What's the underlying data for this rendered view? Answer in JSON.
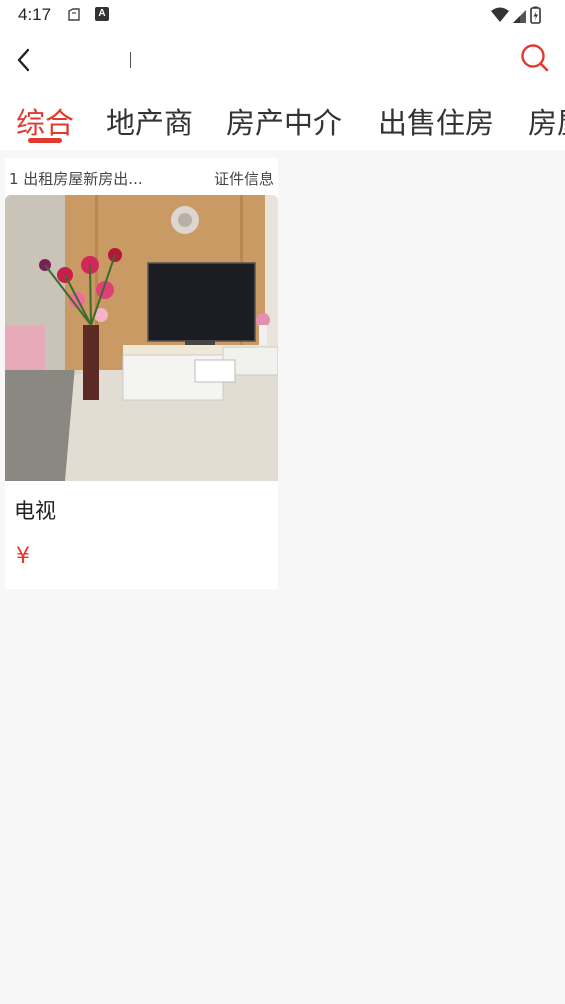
{
  "status_bar": {
    "time": "4:17",
    "notification_icon_letter": "A"
  },
  "header": {
    "search_value": ""
  },
  "tabs": [
    {
      "label": "综合",
      "active": true
    },
    {
      "label": "地产商",
      "active": false
    },
    {
      "label": "房产中介",
      "active": false
    },
    {
      "label": "出售住房",
      "active": false
    },
    {
      "label": "房屋",
      "active": false
    }
  ],
  "results": [
    {
      "shop_name": "1 出租房屋新房出...",
      "cert_label": "证件信息",
      "title": "电视",
      "price": "¥"
    }
  ],
  "colors": {
    "accent": "#e03a2f",
    "background": "#f7f7f7"
  }
}
